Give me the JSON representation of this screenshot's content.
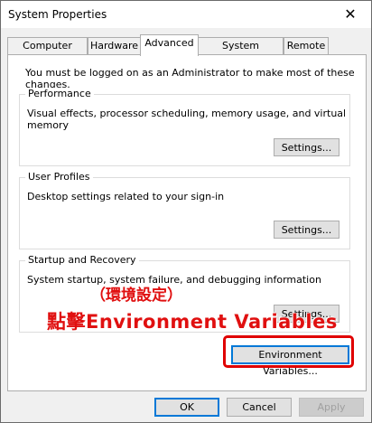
{
  "window": {
    "title": "System Properties",
    "close_glyph": "✕"
  },
  "tabs": [
    {
      "label": "Computer Name",
      "active": false
    },
    {
      "label": "Hardware",
      "active": false
    },
    {
      "label": "Advanced",
      "active": true
    },
    {
      "label": "System Protection",
      "active": false
    },
    {
      "label": "Remote",
      "active": false
    }
  ],
  "advanced": {
    "admin_note": "You must be logged on as an Administrator to make most of these changes.",
    "performance": {
      "title": "Performance",
      "description": "Visual effects, processor scheduling, memory usage, and virtual memory",
      "button": "Settings..."
    },
    "user_profiles": {
      "title": "User Profiles",
      "description": "Desktop settings related to your sign-in",
      "button": "Settings..."
    },
    "startup_recovery": {
      "title": "Startup and Recovery",
      "description": "System startup, system failure, and debugging information",
      "button": "Settings..."
    },
    "env_button": "Environment Variables..."
  },
  "annotation": {
    "line1": "（環境設定）",
    "line2": "點擊Environment Variables",
    "color": "#e01010"
  },
  "footer": {
    "ok": "OK",
    "cancel": "Cancel",
    "apply": "Apply"
  }
}
